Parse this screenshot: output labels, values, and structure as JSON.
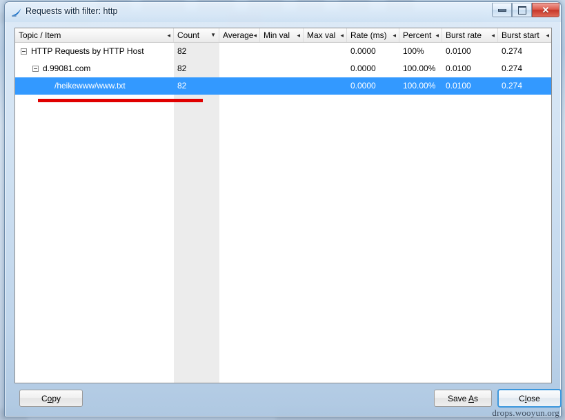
{
  "window": {
    "title": "Requests with filter: http",
    "icon": "wireshark-shark-fin-icon",
    "caption_buttons": {
      "minimize": "minimize-icon",
      "maximize": "maximize-icon",
      "close": "✕"
    }
  },
  "table": {
    "columns": [
      {
        "label": "Topic / Item",
        "mark": "◂",
        "sorted": false
      },
      {
        "label": "Count",
        "mark": "▼",
        "sorted": true
      },
      {
        "label": "Average",
        "mark": "◂",
        "sorted": false
      },
      {
        "label": "Min val",
        "mark": "◂",
        "sorted": false
      },
      {
        "label": "Max val",
        "mark": "◂",
        "sorted": false
      },
      {
        "label": "Rate (ms)",
        "mark": "◂",
        "sorted": false
      },
      {
        "label": "Percent",
        "mark": "◂",
        "sorted": false
      },
      {
        "label": "Burst rate",
        "mark": "◂",
        "sorted": false
      },
      {
        "label": "Burst start",
        "mark": "◂",
        "sorted": false
      }
    ],
    "rows": [
      {
        "topic": "HTTP Requests by HTTP Host",
        "count": "82",
        "average": "",
        "min_val": "",
        "max_val": "",
        "rate_ms": "0.0000",
        "percent": "100%",
        "burst_rate": "0.0100",
        "burst_start": "0.274",
        "depth": 0,
        "expandable": true,
        "selected": false
      },
      {
        "topic": "d.99081.com",
        "count": "82",
        "average": "",
        "min_val": "",
        "max_val": "",
        "rate_ms": "0.0000",
        "percent": "100.00%",
        "burst_rate": "0.0100",
        "burst_start": "0.274",
        "depth": 1,
        "expandable": true,
        "selected": false
      },
      {
        "topic": "/heikewww/www.txt",
        "count": "82",
        "average": "",
        "min_val": "",
        "max_val": "",
        "rate_ms": "0.0000",
        "percent": "100.00%",
        "burst_rate": "0.0100",
        "burst_start": "0.274",
        "depth": 2,
        "expandable": false,
        "selected": true
      }
    ]
  },
  "buttons": {
    "copy": {
      "before": "C",
      "accel": "o",
      "after": "py"
    },
    "save_as": {
      "before": "Save ",
      "accel": "A",
      "after": "s"
    },
    "close": {
      "before": "C",
      "accel": "l",
      "after": "ose"
    }
  },
  "watermark": "drops.wooyun.org",
  "colors": {
    "selection": "#3399ff",
    "sorted_column": "#ececec",
    "annotation": "#e00000",
    "close_button": "#c7372a",
    "focus_ring": "#3c97dd"
  }
}
